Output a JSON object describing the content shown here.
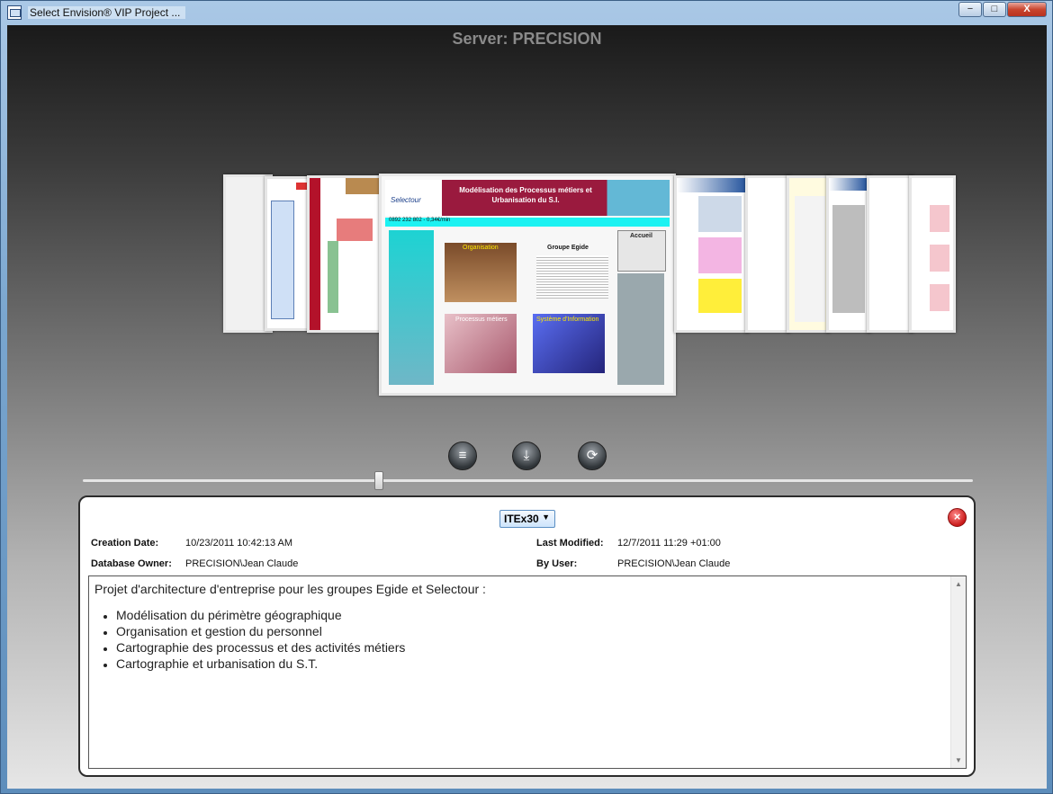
{
  "window": {
    "title": "Select Envision® VIP Project ...",
    "buttons": {
      "minimize": "−",
      "maximize": "□",
      "close": "X"
    }
  },
  "server_title": "Server: PRECISION",
  "center_slide": {
    "header_title": "Modélisation des Processus métiers et Urbanisation du S.I.",
    "logo_text": "Selectour",
    "phone_bar": "0892 232 802 - 0,34€/min",
    "block_organisation": "Organisation",
    "block_groupe": "Groupe Egide",
    "block_processus": "Processus métiers",
    "block_systeme": "Système d'Information",
    "accueil": "Accueil"
  },
  "controls": {
    "database_icon": "database-icon",
    "import_icon": "import-icon",
    "refresh_icon": "refresh-icon",
    "slider_value": 0.33
  },
  "panel": {
    "project_selector": "ITEx30",
    "close_icon": "close-icon",
    "creation_date_label": "Creation Date:",
    "creation_date_value": "10/23/2011 10:42:13 AM",
    "last_modified_label": "Last Modified:",
    "last_modified_value": "12/7/2011 11:29  +01:00",
    "db_owner_label": "Database Owner:",
    "db_owner_value": "PRECISION\\Jean Claude",
    "by_user_label": "By User:",
    "by_user_value": "PRECISION\\Jean Claude",
    "description_intro": "Projet d'architecture d'entreprise pour les groupes Egide et Selectour :",
    "description_items": [
      "Modélisation du périmètre géographique",
      "Organisation et gestion du personnel",
      "Cartographie des processus et des activités métiers",
      "Cartographie et urbanisation du S.T."
    ]
  }
}
